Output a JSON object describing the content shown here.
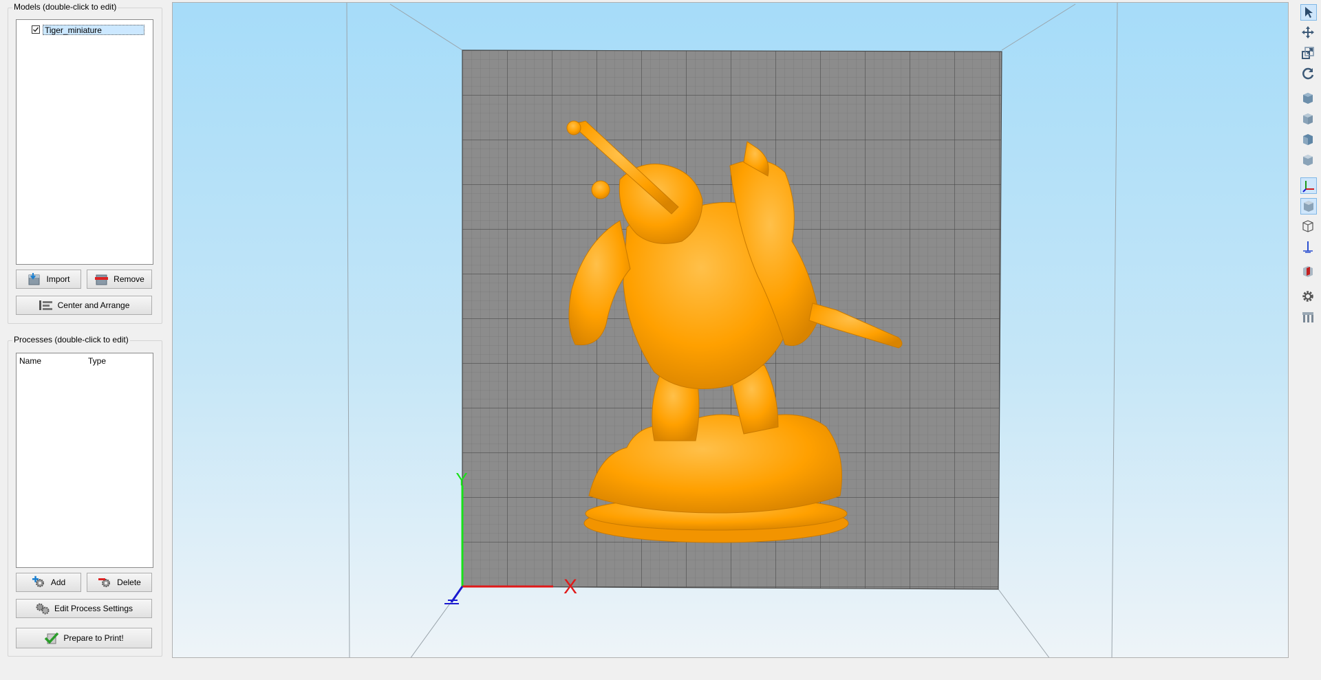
{
  "models_panel": {
    "title": "Models (double-click to edit)",
    "items": [
      {
        "label": "Tiger_miniature",
        "checked": true
      }
    ],
    "import_label": "Import",
    "remove_label": "Remove",
    "center_arrange_label": "Center and Arrange"
  },
  "processes_panel": {
    "title": "Processes (double-click to edit)",
    "columns": [
      "Name",
      "Type"
    ],
    "add_label": "Add",
    "delete_label": "Delete",
    "edit_settings_label": "Edit Process Settings",
    "prepare_label": "Prepare to Print!"
  },
  "viewport": {
    "axis_y_label": "Y",
    "axis_x_label": "X",
    "model_color": "#ffa000",
    "bed_color": "#8c8c8c",
    "sky_color": "#a6dcf9"
  },
  "toolbar": {
    "tools": [
      "select-arrow-icon",
      "move-icon",
      "scale-icon",
      "rotate-icon",
      "view-front-cube-icon",
      "view-top-cube-icon",
      "view-side-cube-icon",
      "view-iso-cube-icon",
      "axes-icon",
      "solid-cube-icon",
      "wireframe-cube-icon",
      "axis-z-icon",
      "cross-section-icon",
      "settings-gear-icon",
      "supports-icon"
    ]
  }
}
